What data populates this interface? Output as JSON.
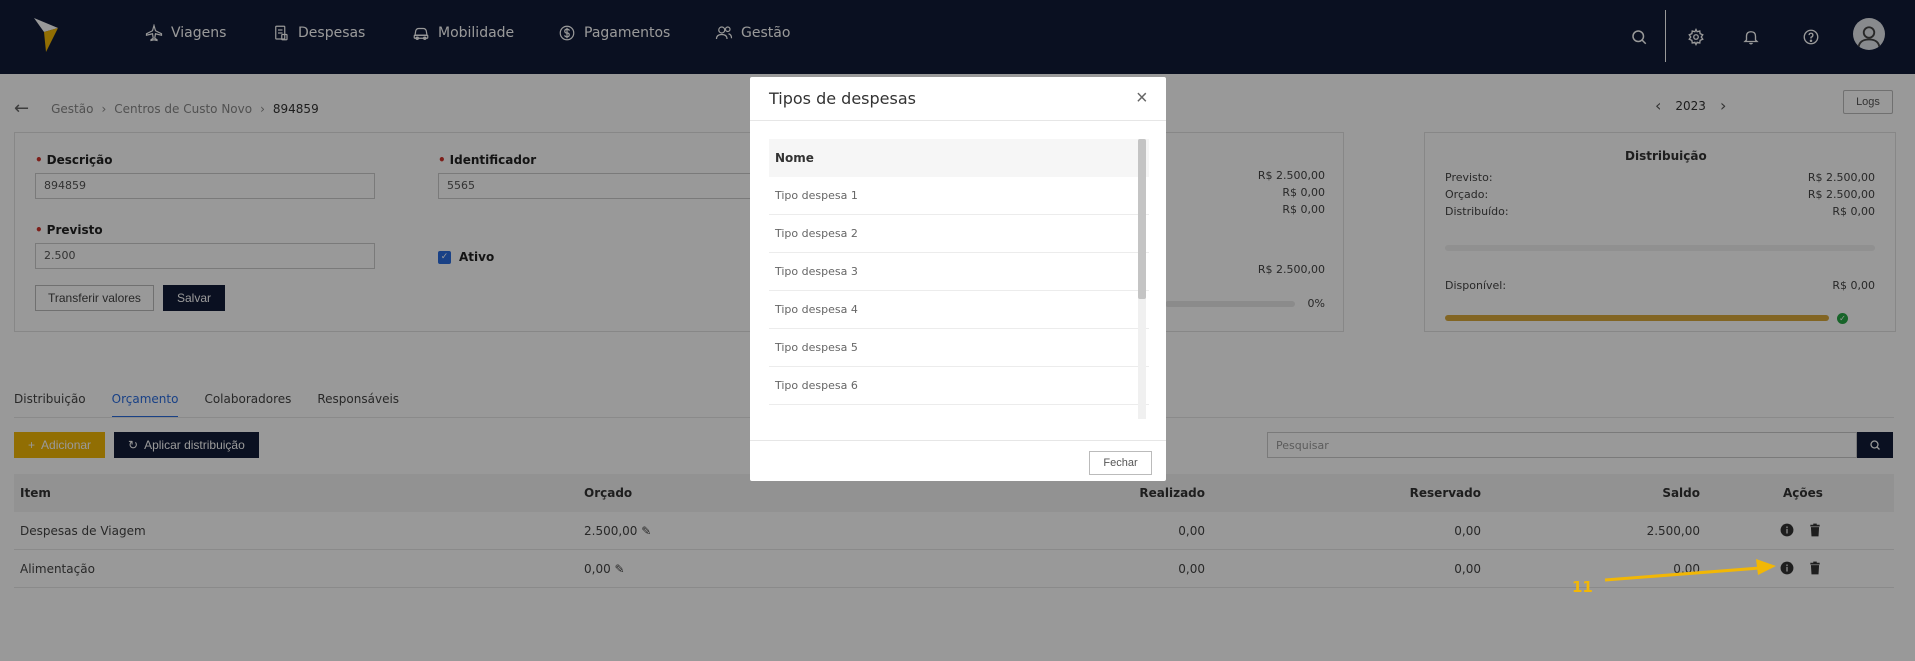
{
  "nav": {
    "items": [
      {
        "label": "Viagens",
        "icon": "plane-icon"
      },
      {
        "label": "Despesas",
        "icon": "receipt-icon"
      },
      {
        "label": "Mobilidade",
        "icon": "car-icon"
      },
      {
        "label": "Pagamentos",
        "icon": "dollar-icon"
      },
      {
        "label": "Gestão",
        "icon": "users-icon"
      }
    ]
  },
  "breadcrumb": {
    "items": [
      "Gestão",
      "Centros de Custo Novo",
      "894859"
    ]
  },
  "year": "2023",
  "logs_label": "Logs",
  "form": {
    "descricao_label": "Descrição",
    "descricao_value": "894859",
    "identificador_label": "Identificador",
    "identificador_value": "5565",
    "previsto_label": "Previsto",
    "previsto_value": "2.500",
    "ativo_label": "Ativo",
    "transferir_label": "Transferir valores",
    "salvar_label": "Salvar"
  },
  "summary": {
    "v1": "R$ 2.500,00",
    "v2": "R$ 0,00",
    "v3": "R$ 0,00",
    "v4": "R$ 2.500,00",
    "pct": "0%"
  },
  "distribuicao": {
    "title": "Distribuição",
    "previsto_label": "Previsto:",
    "previsto_value": "R$ 2.500,00",
    "orcado_label": "Orçado:",
    "orcado_value": "R$ 2.500,00",
    "distribuido_label": "Distribuído:",
    "distribuido_value": "R$ 0,00",
    "disponivel_label": "Disponível:",
    "disponivel_value": "R$ 0,00",
    "bar_fill": 1.0,
    "bar_color": "#d9a93b"
  },
  "tabs": [
    {
      "label": "Distribuição",
      "active": false
    },
    {
      "label": "Orçamento",
      "active": true
    },
    {
      "label": "Colaboradores",
      "active": false
    },
    {
      "label": "Responsáveis",
      "active": false
    }
  ],
  "actions": {
    "add_label": "Adicionar",
    "apply_label": "Aplicar distribuição",
    "search_placeholder": "Pesquisar"
  },
  "table": {
    "headers": {
      "item": "Item",
      "orcado": "Orçado",
      "realizado": "Realizado",
      "reservado": "Reservado",
      "saldo": "Saldo",
      "acoes": "Ações"
    },
    "rows": [
      {
        "item": "Despesas de Viagem",
        "orcado": "2.500,00",
        "realizado": "0,00",
        "reservado": "0,00",
        "saldo": "2.500,00"
      },
      {
        "item": "Alimentação",
        "orcado": "0,00",
        "realizado": "0,00",
        "reservado": "0,00",
        "saldo": "0,00"
      }
    ]
  },
  "modal": {
    "title": "Tipos de despesas",
    "header": "Nome",
    "rows": [
      "Tipo despesa 1",
      "Tipo despesa 2",
      "Tipo despesa 3",
      "Tipo despesa 4",
      "Tipo despesa 5",
      "Tipo despesa 6"
    ],
    "fechar_label": "Fechar"
  },
  "annotation": {
    "label": "11",
    "color": "#f2b705"
  }
}
